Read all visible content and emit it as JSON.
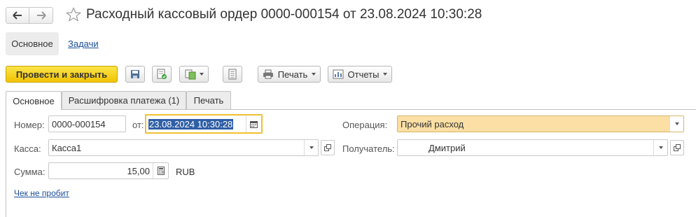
{
  "window": {
    "title": "Расходный кассовый ордер 0000-000154 от 23.08.2024 10:30:28"
  },
  "sections": {
    "main": "Основное",
    "tasks": "Задачи"
  },
  "toolbar": {
    "post_close": "Провести и закрыть",
    "print": "Печать",
    "reports": "Отчеты"
  },
  "tabs": [
    {
      "label": "Основное",
      "active": true
    },
    {
      "label": "Расшифровка платежа (1)",
      "active": false
    },
    {
      "label": "Печать",
      "active": false
    }
  ],
  "form": {
    "number_label": "Номер:",
    "number_value": "0000-000154",
    "date_label": "от:",
    "date_value": "23.08.2024 10:30:28",
    "operation_label": "Операция:",
    "operation_value": "Прочий расход",
    "cash_label": "Касса:",
    "cash_value": "Касса1",
    "recipient_label": "Получатель:",
    "recipient_value": "Дмитрий",
    "sum_label": "Сумма:",
    "sum_value": "15,00",
    "currency": "RUB",
    "receipt_link": "Чек не пробит"
  },
  "colors": {
    "primary_button": "#f5cd10",
    "operation_highlight": "#fbdfa4",
    "focus_border": "#f0c030",
    "link": "#1a4f9b"
  }
}
